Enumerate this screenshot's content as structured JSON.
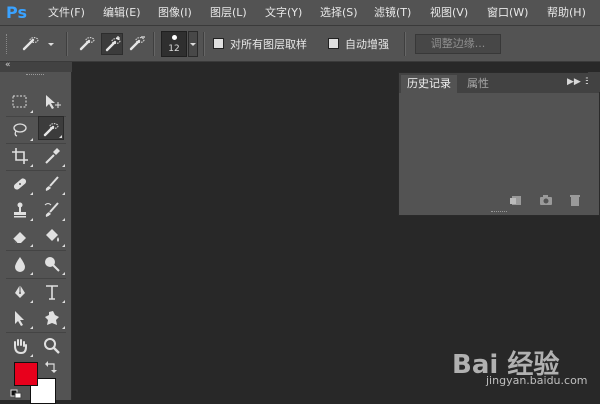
{
  "app": {
    "logo": "Ps"
  },
  "menu": [
    "文件(F)",
    "编辑(E)",
    "图像(I)",
    "图层(L)",
    "文字(Y)",
    "选择(S)",
    "滤镜(T)",
    "视图(V)",
    "窗口(W)",
    "帮助(H)"
  ],
  "options": {
    "brush_size": "12",
    "sample_all_layers_label": "对所有图层取样",
    "sample_all_layers_checked": false,
    "auto_enhance_label": "自动增强",
    "auto_enhance_checked": false,
    "refine_edge_label": "调整边缘..."
  },
  "colors": {
    "foreground": "#e8001c",
    "background": "#ffffff",
    "logo": "#3aa2ff"
  },
  "tools": [
    "rectangular-marquee-icon",
    "move-icon",
    "lasso-icon",
    "quick-selection-icon",
    "crop-icon",
    "eyedropper-icon",
    "spot-healing-icon",
    "brush-icon",
    "clone-stamp-icon",
    "history-brush-icon",
    "eraser-icon",
    "paint-bucket-icon",
    "blur-icon",
    "dodge-icon",
    "pen-icon",
    "type-icon",
    "path-selection-icon",
    "custom-shape-icon",
    "hand-icon",
    "zoom-icon"
  ],
  "history_panel": {
    "tabs": [
      "历史记录",
      "属性"
    ],
    "active_tab": "历史记录"
  },
  "watermark": {
    "logo": "Bai 经验",
    "url": "jingyan.baidu.com"
  }
}
